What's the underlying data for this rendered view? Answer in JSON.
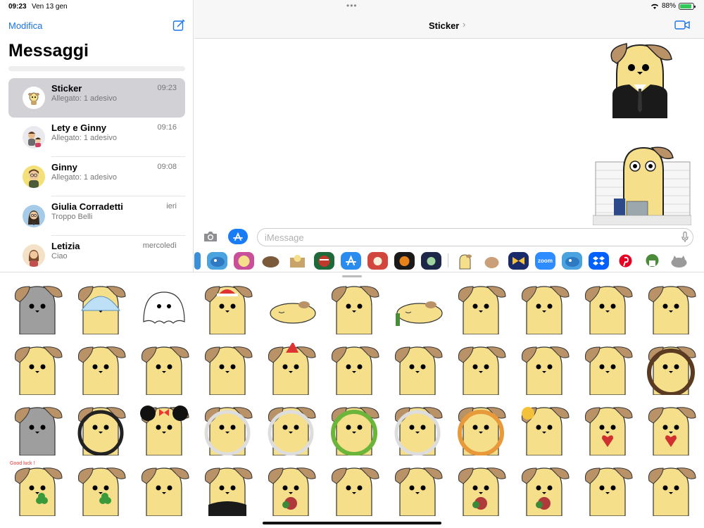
{
  "status_bar": {
    "time": "09:23",
    "date": "Ven 13 gen",
    "battery": "88%",
    "battery_level": 0.88
  },
  "sidebar": {
    "edit_label": "Modifica",
    "title": "Messaggi",
    "conversations": [
      {
        "name": "Sticker",
        "preview": "Allegato: 1 adesivo",
        "time": "09:23"
      },
      {
        "name": "Lety e Ginny",
        "preview": "Allegato: 1 adesivo",
        "time": "09:16"
      },
      {
        "name": "Ginny",
        "preview": "Allegato: 1 adesivo",
        "time": "09:08"
      },
      {
        "name": "Giulia Corradetti",
        "preview": "Troppo Belli",
        "time": "ieri"
      },
      {
        "name": "Letizia",
        "preview": "Ciao",
        "time": "mercoledì"
      }
    ]
  },
  "conversation": {
    "title": "Sticker",
    "input_placeholder": "iMessage"
  },
  "app_strip": {
    "zoom_label": "zoom"
  },
  "sticker_drawer": {
    "good_luck_text": "Good luck !",
    "sticker_count": 44
  },
  "colors": {
    "accent": "#1a73e8",
    "selected_row": "#d1d1d6",
    "dog_body": "#f5df8a",
    "dog_ear": "#b99268"
  }
}
